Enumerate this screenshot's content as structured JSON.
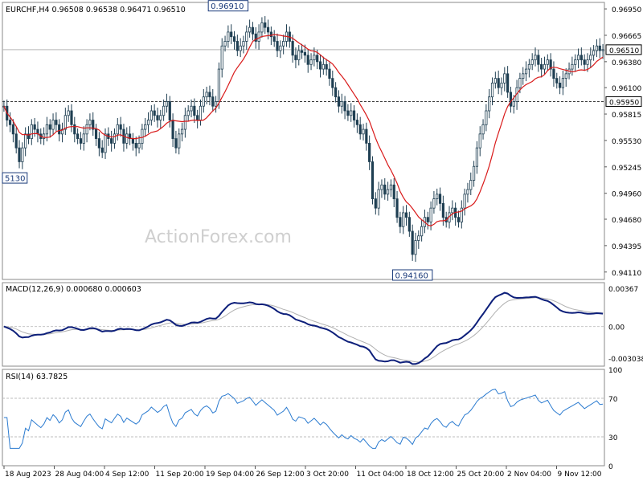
{
  "chart_data": [
    {
      "type": "candlestick",
      "panel": "price",
      "symbol_line": "EURCHF,H4  0.96508 0.96538 0.96471 0.96510",
      "watermark": "ActionForex.com",
      "ylim": [
        0.9403,
        0.9702
      ],
      "yticks": [
        "0.96950",
        "0.96665",
        "0.96380",
        "0.96100",
        "0.95815",
        "0.95530",
        "0.95245",
        "0.94960",
        "0.94680",
        "0.94395",
        "0.94110"
      ],
      "ytick_values": [
        0.9695,
        0.96665,
        0.9638,
        0.961,
        0.95815,
        0.9553,
        0.95245,
        0.9496,
        0.9468,
        0.94395,
        0.9411
      ],
      "current_price_label": "0.96510",
      "current_price": 0.9651,
      "level_label": "0.95950",
      "level": 0.9595,
      "annotations": [
        {
          "text": "0.96910",
          "x_bar": 73,
          "value": 0.9691
        },
        {
          "text": "5130",
          "x_bar": 0,
          "value": 0.9513
        },
        {
          "text": "0.94160",
          "x_bar": 133,
          "value": 0.9416
        }
      ],
      "series_close": [
        0.959,
        0.9575,
        0.957,
        0.956,
        0.9545,
        0.953,
        0.9545,
        0.956,
        0.9555,
        0.957,
        0.9565,
        0.956,
        0.9555,
        0.956,
        0.957,
        0.9565,
        0.9575,
        0.957,
        0.956,
        0.9565,
        0.958,
        0.9585,
        0.957,
        0.956,
        0.9555,
        0.955,
        0.956,
        0.957,
        0.9575,
        0.9565,
        0.9555,
        0.9545,
        0.954,
        0.956,
        0.9555,
        0.955,
        0.956,
        0.957,
        0.9565,
        0.955,
        0.956,
        0.9555,
        0.955,
        0.9545,
        0.955,
        0.9565,
        0.957,
        0.9575,
        0.9585,
        0.958,
        0.9575,
        0.958,
        0.959,
        0.9595,
        0.9575,
        0.9555,
        0.9545,
        0.956,
        0.9565,
        0.958,
        0.9585,
        0.959,
        0.958,
        0.9575,
        0.959,
        0.96,
        0.9605,
        0.96,
        0.959,
        0.9595,
        0.963,
        0.9655,
        0.966,
        0.967,
        0.9665,
        0.966,
        0.965,
        0.9655,
        0.966,
        0.967,
        0.9675,
        0.9668,
        0.966,
        0.967,
        0.968,
        0.9675,
        0.967,
        0.9665,
        0.966,
        0.965,
        0.9655,
        0.966,
        0.967,
        0.966,
        0.9645,
        0.964,
        0.965,
        0.9648,
        0.9645,
        0.9635,
        0.964,
        0.9645,
        0.9638,
        0.963,
        0.9635,
        0.963,
        0.962,
        0.961,
        0.96,
        0.959,
        0.9595,
        0.9585,
        0.958,
        0.9585,
        0.9575,
        0.957,
        0.956,
        0.9565,
        0.955,
        0.953,
        0.949,
        0.948,
        0.95,
        0.9505,
        0.9495,
        0.95,
        0.9505,
        0.949,
        0.947,
        0.946,
        0.9475,
        0.947,
        0.9455,
        0.943,
        0.9445,
        0.945,
        0.946,
        0.947,
        0.9465,
        0.948,
        0.949,
        0.9495,
        0.9485,
        0.947,
        0.9465,
        0.9475,
        0.948,
        0.947,
        0.9465,
        0.948,
        0.9495,
        0.95,
        0.951,
        0.9525,
        0.9545,
        0.956,
        0.957,
        0.9585,
        0.96,
        0.9615,
        0.962,
        0.961,
        0.9615,
        0.9625,
        0.9605,
        0.959,
        0.9595,
        0.961,
        0.962,
        0.9625,
        0.963,
        0.9635,
        0.964,
        0.9645,
        0.9635,
        0.963,
        0.9635,
        0.964,
        0.963,
        0.962,
        0.9615,
        0.961,
        0.962,
        0.9625,
        0.963,
        0.9635,
        0.964,
        0.9645,
        0.964,
        0.9635,
        0.964,
        0.9645,
        0.965,
        0.9655,
        0.965,
        0.9651
      ],
      "moving_average": {
        "color": "#d91a1a"
      },
      "colors": {
        "candle": "#1f3f52",
        "grid": "#cfcfcf",
        "level": "#3c3c3c"
      }
    },
    {
      "type": "line",
      "panel": "macd",
      "label": "MACD(12,26,9) 0.000680 0.000603",
      "ylim": [
        -0.0038,
        0.0042
      ],
      "yticks": [
        "0.00367",
        "0.00",
        "-0.003038"
      ],
      "ytick_values": [
        0.00367,
        0.0,
        -0.003038
      ],
      "colors": {
        "macd": "#0d1f7a",
        "signal": "#b0b0b0"
      }
    },
    {
      "type": "line",
      "panel": "rsi",
      "label": "RSI(14) 63.7825",
      "ylim": [
        0,
        100
      ],
      "yticks": [
        "100",
        "70",
        "30",
        "0"
      ],
      "ytick_values": [
        100,
        70,
        30,
        0
      ],
      "levels": [
        70,
        30
      ],
      "colors": {
        "rsi": "#2b7bd0"
      }
    }
  ],
  "x_axis_labels": [
    "18 Aug 2023",
    "28 Aug 04:00",
    "4 Sep 12:00",
    "11 Sep 20:00",
    "19 Sep 04:00",
    "26 Sep 12:00",
    "3 Oct 20:00",
    "11 Oct 04:00",
    "18 Oct 12:00",
    "25 Oct 20:00",
    "2 Nov 04:00",
    "9 Nov 12:00"
  ]
}
